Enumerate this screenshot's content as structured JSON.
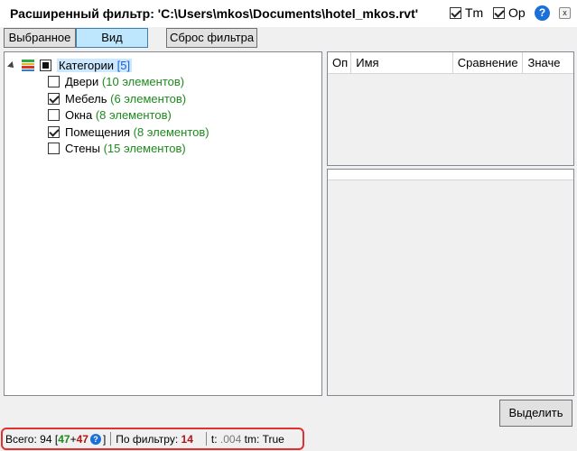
{
  "title": "Расширенный фильтр: 'C:\\Users\\mkos\\Documents\\hotel_mkos.rvt'",
  "options": {
    "tm_label": "Tm",
    "tm_checked": true,
    "op_label": "Op",
    "op_checked": true,
    "help_glyph": "?",
    "close_glyph": "x"
  },
  "toolbar": {
    "selected_label": "Выбранное",
    "view_label": "Вид",
    "reset_label": "Сброс фильтра"
  },
  "tree": {
    "root_label": "Категории",
    "root_count": "[5]",
    "items": [
      {
        "label": "Двери",
        "count": "(10 элементов)",
        "checked": false
      },
      {
        "label": "Мебель",
        "count": "(6 элементов)",
        "checked": true
      },
      {
        "label": "Окна",
        "count": "(8 элементов)",
        "checked": false
      },
      {
        "label": "Помещения",
        "count": "(8 элементов)",
        "checked": true
      },
      {
        "label": "Стены",
        "count": "(15 элементов)",
        "checked": false
      }
    ]
  },
  "grid": {
    "columns": [
      "Оп",
      "Имя",
      "Сравнение",
      "Значе"
    ]
  },
  "select_button": "Выделить",
  "status": {
    "total_label": "Всего:",
    "total_value": "94",
    "bracket_open": "[",
    "green_value": "47",
    "plus": "+",
    "red_value": "47",
    "help_glyph": "?",
    "bracket_close": "]",
    "filter_label": "По фильтру:",
    "filter_value": "14",
    "t_label": "t:",
    "t_value": ".004",
    "tm_label": "tm:",
    "tm_value": "True"
  },
  "colors": {
    "accent": "#1a6fd8",
    "count_green": "#1d8a1d",
    "count_blue": "#1a5fd6",
    "status_red": "#b01515",
    "highlight_border": "#e03030"
  }
}
